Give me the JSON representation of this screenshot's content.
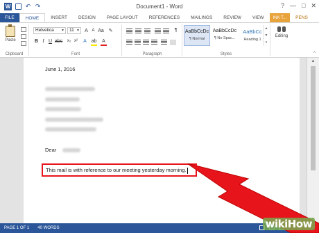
{
  "window": {
    "title": "Document1 - Word",
    "app_icon_letter": "W",
    "controls": [
      "?",
      "—",
      "□",
      "✕"
    ]
  },
  "ribbon_tabs": [
    "FILE",
    "HOME",
    "INSERT",
    "DESIGN",
    "PAGE LAYOUT",
    "REFERENCES",
    "MAILINGS",
    "REVIEW",
    "VIEW",
    "INK T...",
    "PENS"
  ],
  "ribbon": {
    "clipboard": {
      "label": "Clipboard",
      "paste": "Paste"
    },
    "font": {
      "label": "Font",
      "name": "Helvetica",
      "size": "11"
    },
    "paragraph": {
      "label": "Paragraph"
    },
    "styles": {
      "label": "Styles",
      "items": [
        {
          "preview": "AaBbCcDc",
          "name": "¶ Normal"
        },
        {
          "preview": "AaBbCcDc",
          "name": "¶ No Spac..."
        },
        {
          "preview": "AaBbCc",
          "name": "Heading 1"
        }
      ]
    },
    "editing": {
      "label": "Editing"
    }
  },
  "document": {
    "date": "June 1, 2016",
    "salutation": "Dear",
    "highlighted_line": "This mail is with reference to our meeting yesterday morning."
  },
  "statusbar": {
    "page": "PAGE 1 OF 1",
    "words": "40 WORDS"
  },
  "watermark": "wikiHow",
  "colors": {
    "word_blue": "#2b579a",
    "highlight_border": "#e8141b",
    "overlay_arrow": "#e8141b",
    "ink_tab": "#e8a33a"
  }
}
